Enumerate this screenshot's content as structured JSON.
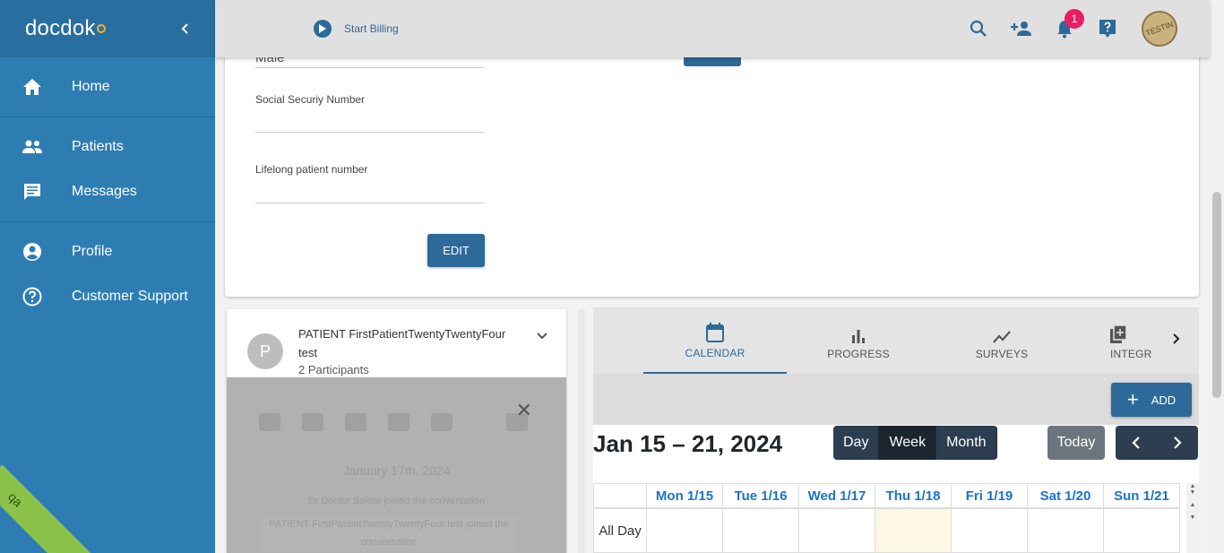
{
  "sidebar": {
    "logo": "docdok",
    "items": [
      {
        "label": "Home",
        "icon": "home-icon"
      },
      {
        "label": "Patients",
        "icon": "people-icon"
      },
      {
        "label": "Messages",
        "icon": "message-icon"
      },
      {
        "label": "Profile",
        "icon": "account-circle-icon"
      },
      {
        "label": "Customer Support",
        "icon": "help-circle-icon"
      }
    ],
    "env_badge": "qa"
  },
  "topbar": {
    "billing_label": "Start Billing",
    "notifications_count": "1",
    "avatar_text": "TESTIN"
  },
  "profile": {
    "gender_value": "Male",
    "ssn_label": "Social Securiy Number",
    "ssn_value": "",
    "lifelong_label": "Lifelong patient number",
    "lifelong_value": "",
    "edit_label": "EDIT"
  },
  "conversation": {
    "avatar_letter": "P",
    "title": "PATIENT FirstPatientTwentyTwentyFour test",
    "participants": "2 Participants",
    "date": "January 17th, 2024",
    "messages": [
      "Dr Doctor Salota joined the conversation",
      "PATIENT FirstPatientTwentyTwentyFour test joined the conversation"
    ]
  },
  "tabs": [
    {
      "label": "CALENDAR",
      "icon": "calendar-icon",
      "active": true
    },
    {
      "label": "PROGRESS",
      "icon": "bar-chart-icon",
      "active": false
    },
    {
      "label": "SURVEYS",
      "icon": "trend-line-icon",
      "active": false
    },
    {
      "label": "INTEGR",
      "icon": "library-add-icon",
      "active": false
    }
  ],
  "calendar": {
    "add_label": "ADD",
    "range_title": "Jan 15 – 21, 2024",
    "views": [
      "Day",
      "Week",
      "Month"
    ],
    "active_view": "Week",
    "today_label": "Today",
    "all_day_label": "All Day",
    "days": [
      "Mon 1/15",
      "Tue 1/16",
      "Wed 1/17",
      "Thu 1/18",
      "Fri 1/19",
      "Sat 1/20",
      "Sun 1/21"
    ],
    "today_index": 3
  },
  "colors": {
    "sidebar": "#2d7db3",
    "primary": "#2d6a99",
    "badge": "#e91e63",
    "calendar_nav": "#2c3e50",
    "today_highlight": "#fcf8e3"
  }
}
